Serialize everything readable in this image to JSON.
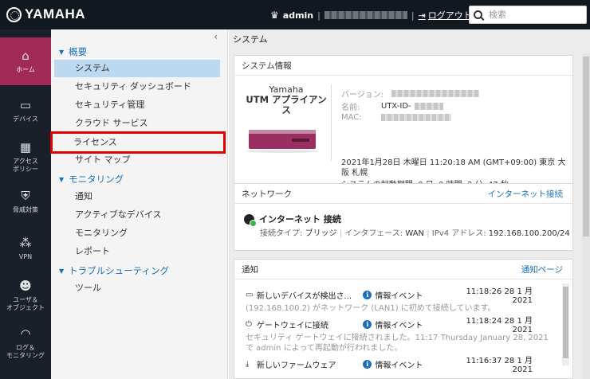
{
  "header": {
    "brand": "YAMAHA",
    "user": "admin",
    "logout": "ログアウト",
    "search_placeholder": "検索"
  },
  "leftnav": [
    {
      "label": "ホーム",
      "icon": "home-icon",
      "active": true
    },
    {
      "label": "デバイス",
      "icon": "device-icon"
    },
    {
      "label": "アクセス\nポリシー",
      "icon": "access-policy-icon"
    },
    {
      "label": "脅威対策",
      "icon": "shield-icon"
    },
    {
      "label": "VPN",
      "icon": "vpn-icon"
    },
    {
      "label": "ユーザ＆\nオブジェクト",
      "icon": "users-icon"
    },
    {
      "label": "ログ＆\nモニタリング",
      "icon": "gauge-icon"
    }
  ],
  "menu": {
    "collapse_glyph": "‹",
    "groups": [
      {
        "label": "概要",
        "items": [
          "システム",
          "セキュリティ ダッシュボード",
          "セキュリティ管理",
          "クラウド サービス",
          "ライセンス",
          "サイト マップ"
        ]
      },
      {
        "label": "モニタリング",
        "items": [
          "通知",
          "アクティブなデバイス",
          "モニタリング",
          "レポート"
        ]
      },
      {
        "label": "トラブルシューティング",
        "items": [
          "ツール"
        ]
      }
    ]
  },
  "main": {
    "title": "システム",
    "system_info": {
      "heading": "システム情報",
      "device_brand": "Yamaha",
      "device_model": "UTM アプライアンス",
      "version_label": "バージョン:",
      "name_label": "名前:",
      "name_prefix": "UTX-ID-",
      "mac_label": "MAC:",
      "datetime": "2021年1月28日 木曜日 11:20:18 AM (GMT+09:00) 東京 大阪 札幌",
      "uptime": "システムの起動期間: 0 日, 0 時間, 2 分, 47 秒"
    },
    "network": {
      "heading": "ネットワーク",
      "link": "インターネット接続",
      "title": "インターネット 接続",
      "conn_type_label": "接続タイプ:",
      "conn_type": "ブリッジ",
      "interface_label": "インタフェース:",
      "interface": "WAN",
      "ipv4_label": "IPv4 アドレス:",
      "ipv4": "192.168.100.200/24"
    },
    "notifications": {
      "heading": "通知",
      "link": "通知ページ",
      "items": [
        {
          "icon": "monitor-icon",
          "title": "新しいデバイスが検出さ...",
          "type": "情報イベント",
          "time": "11:18:26 28 1 月 2021",
          "message": "(192.168.100.2) がネットワーク (LAN1) に初めて接続しています。"
        },
        {
          "icon": "power-icon",
          "title": "ゲートウェイに接続",
          "type": "情報イベント",
          "time": "11:18:24 28 1 月 2021",
          "message": "セキュリティ ゲートウェイに接続されました。11:17 Thursday January 28, 2021 で admin によって再起動が行われました。"
        },
        {
          "icon": "download-icon",
          "title": "新しいファームウェア",
          "type": "情報イベント",
          "time": "11:16:37 28 1 月 2021",
          "message": ""
        }
      ]
    }
  }
}
